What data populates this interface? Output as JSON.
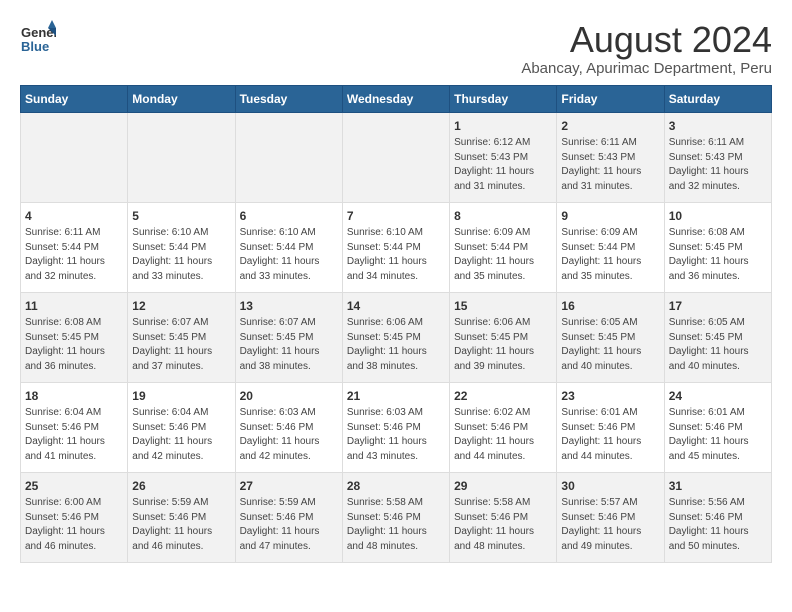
{
  "header": {
    "logo_line1": "General",
    "logo_line2": "Blue",
    "title": "August 2024",
    "subtitle": "Abancay, Apurimac Department, Peru"
  },
  "days_of_week": [
    "Sunday",
    "Monday",
    "Tuesday",
    "Wednesday",
    "Thursday",
    "Friday",
    "Saturday"
  ],
  "weeks": [
    [
      {
        "day": "",
        "info": ""
      },
      {
        "day": "",
        "info": ""
      },
      {
        "day": "",
        "info": ""
      },
      {
        "day": "",
        "info": ""
      },
      {
        "day": "1",
        "info": "Sunrise: 6:12 AM\nSunset: 5:43 PM\nDaylight: 11 hours\nand 31 minutes."
      },
      {
        "day": "2",
        "info": "Sunrise: 6:11 AM\nSunset: 5:43 PM\nDaylight: 11 hours\nand 31 minutes."
      },
      {
        "day": "3",
        "info": "Sunrise: 6:11 AM\nSunset: 5:43 PM\nDaylight: 11 hours\nand 32 minutes."
      }
    ],
    [
      {
        "day": "4",
        "info": "Sunrise: 6:11 AM\nSunset: 5:44 PM\nDaylight: 11 hours\nand 32 minutes."
      },
      {
        "day": "5",
        "info": "Sunrise: 6:10 AM\nSunset: 5:44 PM\nDaylight: 11 hours\nand 33 minutes."
      },
      {
        "day": "6",
        "info": "Sunrise: 6:10 AM\nSunset: 5:44 PM\nDaylight: 11 hours\nand 33 minutes."
      },
      {
        "day": "7",
        "info": "Sunrise: 6:10 AM\nSunset: 5:44 PM\nDaylight: 11 hours\nand 34 minutes."
      },
      {
        "day": "8",
        "info": "Sunrise: 6:09 AM\nSunset: 5:44 PM\nDaylight: 11 hours\nand 35 minutes."
      },
      {
        "day": "9",
        "info": "Sunrise: 6:09 AM\nSunset: 5:44 PM\nDaylight: 11 hours\nand 35 minutes."
      },
      {
        "day": "10",
        "info": "Sunrise: 6:08 AM\nSunset: 5:45 PM\nDaylight: 11 hours\nand 36 minutes."
      }
    ],
    [
      {
        "day": "11",
        "info": "Sunrise: 6:08 AM\nSunset: 5:45 PM\nDaylight: 11 hours\nand 36 minutes."
      },
      {
        "day": "12",
        "info": "Sunrise: 6:07 AM\nSunset: 5:45 PM\nDaylight: 11 hours\nand 37 minutes."
      },
      {
        "day": "13",
        "info": "Sunrise: 6:07 AM\nSunset: 5:45 PM\nDaylight: 11 hours\nand 38 minutes."
      },
      {
        "day": "14",
        "info": "Sunrise: 6:06 AM\nSunset: 5:45 PM\nDaylight: 11 hours\nand 38 minutes."
      },
      {
        "day": "15",
        "info": "Sunrise: 6:06 AM\nSunset: 5:45 PM\nDaylight: 11 hours\nand 39 minutes."
      },
      {
        "day": "16",
        "info": "Sunrise: 6:05 AM\nSunset: 5:45 PM\nDaylight: 11 hours\nand 40 minutes."
      },
      {
        "day": "17",
        "info": "Sunrise: 6:05 AM\nSunset: 5:45 PM\nDaylight: 11 hours\nand 40 minutes."
      }
    ],
    [
      {
        "day": "18",
        "info": "Sunrise: 6:04 AM\nSunset: 5:46 PM\nDaylight: 11 hours\nand 41 minutes."
      },
      {
        "day": "19",
        "info": "Sunrise: 6:04 AM\nSunset: 5:46 PM\nDaylight: 11 hours\nand 42 minutes."
      },
      {
        "day": "20",
        "info": "Sunrise: 6:03 AM\nSunset: 5:46 PM\nDaylight: 11 hours\nand 42 minutes."
      },
      {
        "day": "21",
        "info": "Sunrise: 6:03 AM\nSunset: 5:46 PM\nDaylight: 11 hours\nand 43 minutes."
      },
      {
        "day": "22",
        "info": "Sunrise: 6:02 AM\nSunset: 5:46 PM\nDaylight: 11 hours\nand 44 minutes."
      },
      {
        "day": "23",
        "info": "Sunrise: 6:01 AM\nSunset: 5:46 PM\nDaylight: 11 hours\nand 44 minutes."
      },
      {
        "day": "24",
        "info": "Sunrise: 6:01 AM\nSunset: 5:46 PM\nDaylight: 11 hours\nand 45 minutes."
      }
    ],
    [
      {
        "day": "25",
        "info": "Sunrise: 6:00 AM\nSunset: 5:46 PM\nDaylight: 11 hours\nand 46 minutes."
      },
      {
        "day": "26",
        "info": "Sunrise: 5:59 AM\nSunset: 5:46 PM\nDaylight: 11 hours\nand 46 minutes."
      },
      {
        "day": "27",
        "info": "Sunrise: 5:59 AM\nSunset: 5:46 PM\nDaylight: 11 hours\nand 47 minutes."
      },
      {
        "day": "28",
        "info": "Sunrise: 5:58 AM\nSunset: 5:46 PM\nDaylight: 11 hours\nand 48 minutes."
      },
      {
        "day": "29",
        "info": "Sunrise: 5:58 AM\nSunset: 5:46 PM\nDaylight: 11 hours\nand 48 minutes."
      },
      {
        "day": "30",
        "info": "Sunrise: 5:57 AM\nSunset: 5:46 PM\nDaylight: 11 hours\nand 49 minutes."
      },
      {
        "day": "31",
        "info": "Sunrise: 5:56 AM\nSunset: 5:46 PM\nDaylight: 11 hours\nand 50 minutes."
      }
    ]
  ]
}
